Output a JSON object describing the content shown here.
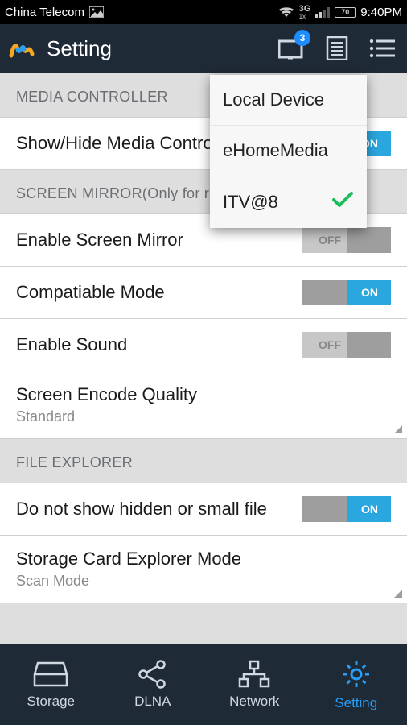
{
  "statusbar": {
    "carrier": "China Telecom",
    "net_label": "3G",
    "net_sub": "1x",
    "battery": "70",
    "time": "9:40PM"
  },
  "actionbar": {
    "title": "Setting",
    "cast_badge": "3"
  },
  "sections": {
    "media_controller": "MEDIA CONTROLLER",
    "screen_mirror": "SCREEN MIRROR(Only for ren)",
    "file_explorer": "FILE EXPLORER"
  },
  "rows": {
    "show_hide": {
      "label": "Show/Hide Media Controller",
      "state": "ON"
    },
    "enable_mirror": {
      "label": "Enable Screen Mirror",
      "state": "OFF"
    },
    "compatible": {
      "label": "Compatiable Mode",
      "state": "ON"
    },
    "enable_sound": {
      "label": "Enable Sound",
      "state": "OFF"
    },
    "encode_quality": {
      "label": "Screen Encode Quality",
      "sub": "Standard"
    },
    "hidden_files": {
      "label": "Do not show hidden or small file",
      "state": "ON"
    },
    "storage_mode": {
      "label": "Storage Card Explorer Mode",
      "sub": "Scan Mode"
    }
  },
  "popup": {
    "items": [
      "Local Device",
      "eHomeMedia",
      "ITV@8"
    ],
    "selected_index": 2
  },
  "bottomnav": {
    "items": [
      "Storage",
      "DLNA",
      "Network",
      "Setting"
    ],
    "active_index": 3
  }
}
